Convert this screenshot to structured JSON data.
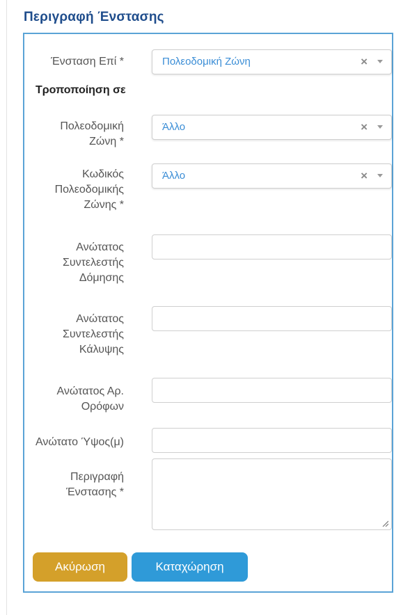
{
  "section": {
    "title": "Περιγραφή Ένστασης"
  },
  "form": {
    "objection_on": {
      "label": "Ένσταση Επί *",
      "value": "Πολεοδομική Ζώνη"
    },
    "subheading": "Τροποποίηση σε",
    "urban_zone": {
      "label_lines": [
        "Πολεοδομική",
        "Ζώνη *"
      ],
      "value": "Άλλο"
    },
    "urban_zone_code": {
      "label_lines": [
        "Κωδικός",
        "Πολεοδομικής",
        "Ζώνης *"
      ],
      "value": "Άλλο"
    },
    "max_building_coef": {
      "label_lines": [
        "Ανώτατος",
        "Συντελεστής",
        "Δόμησης"
      ],
      "value": ""
    },
    "max_coverage_coef": {
      "label_lines": [
        "Ανώτατος",
        "Συντελεστής",
        "Κάλυψης"
      ],
      "value": ""
    },
    "max_floors": {
      "label_lines": [
        "Ανώτατος Αρ.",
        "Ορόφων"
      ],
      "value": ""
    },
    "max_height": {
      "label": "Ανώτατο Ύψος(μ)",
      "value": ""
    },
    "description": {
      "label_lines": [
        "Περιγραφή",
        "Ένστασης *"
      ],
      "value": ""
    },
    "clear_symbol": "×"
  },
  "buttons": {
    "cancel": "Ακύρωση",
    "submit": "Καταχώρηση"
  },
  "colors": {
    "title": "#1f4d8c",
    "panel_border": "#5aa3d6",
    "select_value": "#3a8dd6",
    "cancel_button": "#d4a02a",
    "submit_button": "#2f9ad8"
  }
}
